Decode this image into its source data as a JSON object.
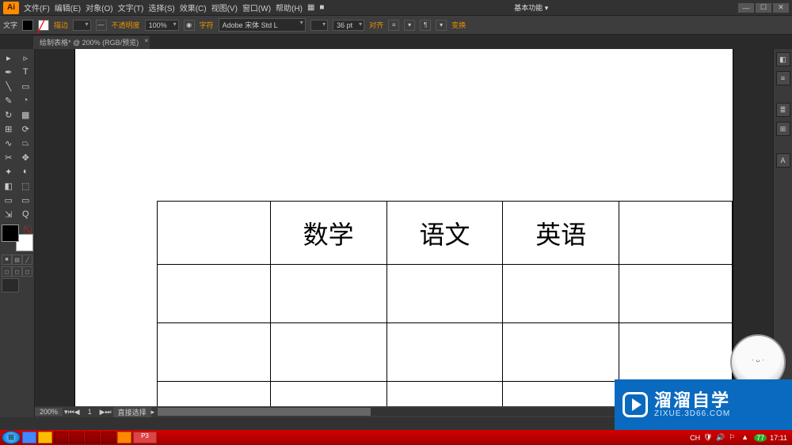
{
  "app": {
    "logo": "Ai",
    "workspace_label": "基本功能"
  },
  "menu": {
    "items": [
      "文件(F)",
      "编辑(E)",
      "对象(O)",
      "文字(T)",
      "选择(S)",
      "效果(C)",
      "视图(V)",
      "窗口(W)",
      "帮助(H)"
    ]
  },
  "options": {
    "tool_label": "文字",
    "fill_swatch": "#000000",
    "stroke_swatch_none": true,
    "stroke_label": "描边",
    "opacity_label": "不透明度",
    "opacity_value": "100%",
    "font_label": "字符",
    "font_value": "Adobe 宋体 Std L",
    "size_value": "36 pt",
    "align_label": "对齐",
    "transform_label": "变换"
  },
  "tab": {
    "title": "绘制表格* @ 200% (RGB/预览)"
  },
  "canvas": {
    "zoom": "200%",
    "status_selection": "直接选择",
    "table": {
      "rows": [
        [
          "",
          "数学",
          "语文",
          "英语",
          ""
        ],
        [
          "",
          "",
          "",
          "",
          ""
        ],
        [
          "",
          "",
          "",
          "",
          ""
        ],
        [
          "",
          "",
          "",
          "",
          ""
        ]
      ]
    }
  },
  "tools": [
    [
      "▸",
      "▹"
    ],
    [
      "✒",
      "T"
    ],
    [
      "╲",
      "▭"
    ],
    [
      "✎",
      "◔"
    ],
    [
      "↻",
      "▦"
    ],
    [
      "⊞",
      "⟳"
    ],
    [
      "∿",
      "⏢"
    ],
    [
      "✂",
      "✥"
    ],
    [
      "✦",
      "◐"
    ],
    [
      "◧",
      "⬚"
    ],
    [
      "▭",
      "▭"
    ],
    [
      "⇲",
      "Q"
    ]
  ],
  "right_panels": [
    "◧",
    "≡",
    "≣",
    "⊞",
    "A"
  ],
  "watermark": {
    "title": "溜溜自学",
    "sub": "ZIXUE.3D66.COM"
  },
  "taskbar": {
    "tray_text": "CH",
    "clock": "17:11",
    "indicator": "77"
  }
}
